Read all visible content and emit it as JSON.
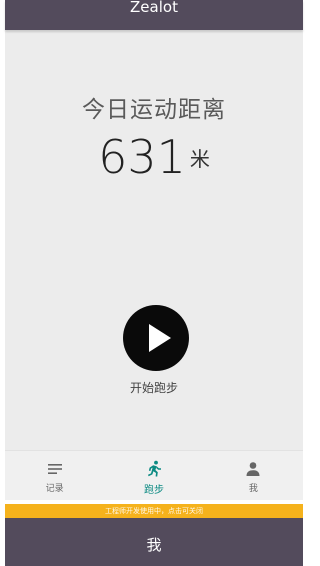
{
  "header": {
    "title": "Zealot"
  },
  "main": {
    "distance_label": "今日运动距离",
    "distance_value": "631",
    "distance_unit": "米",
    "start_label": "开始跑步"
  },
  "tabs": [
    {
      "label": "记录",
      "icon": "list-icon",
      "active": false
    },
    {
      "label": "跑步",
      "icon": "run-icon",
      "active": true
    },
    {
      "label": "我",
      "icon": "person-icon",
      "active": false
    }
  ],
  "dev_banner": {
    "text": "工程师开发使用中，点击可关闭"
  },
  "footer": {
    "title": "我"
  },
  "colors": {
    "bar": "#534b5c",
    "content_bg": "#ececec",
    "accent": "#0b8a82",
    "banner": "#f5b21c"
  }
}
